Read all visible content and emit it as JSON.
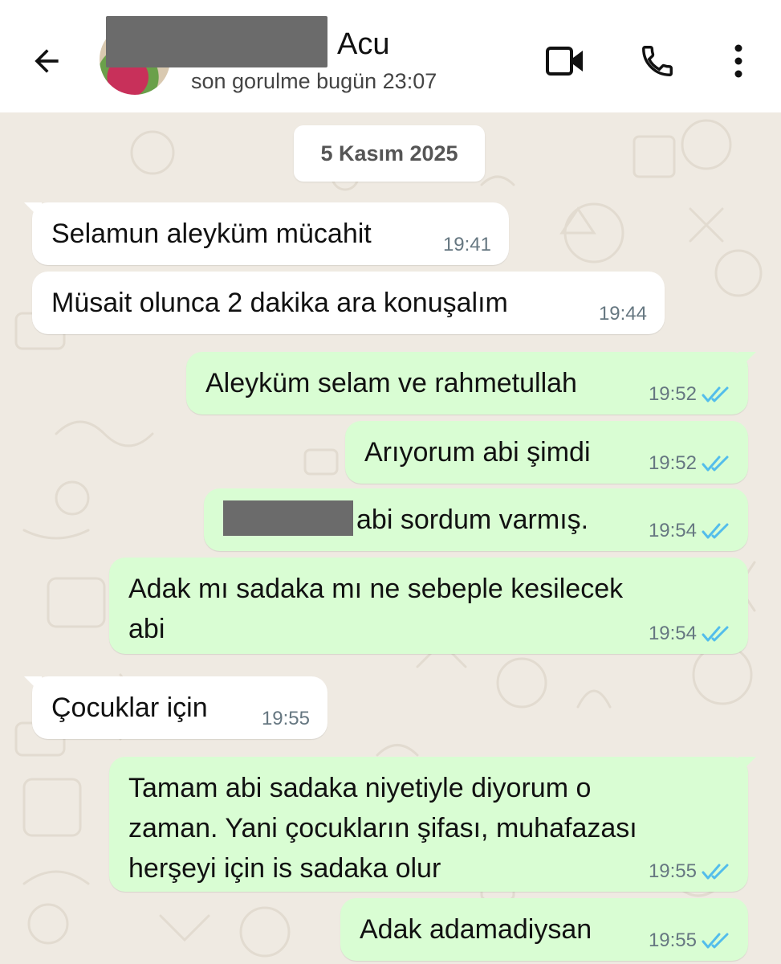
{
  "header": {
    "contact_name": "Acu",
    "status": "son gorulme bugün 23:07",
    "icons": [
      "back-arrow-icon",
      "video-call-icon",
      "phone-icon",
      "more-vertical-icon"
    ]
  },
  "chat": {
    "date_chip": "5 Kasım 2025",
    "messages": [
      {
        "dir": "in",
        "text": "Selamun aleyküm mücahit",
        "time": "19:41"
      },
      {
        "dir": "in",
        "text": "Müsait olunca 2 dakika ara konuşalım",
        "time": "19:44"
      },
      {
        "dir": "out",
        "text": "Aleyküm selam ve rahmetullah",
        "time": "19:52",
        "status": "read"
      },
      {
        "dir": "out",
        "text": "Arıyorum abi şimdi",
        "time": "19:52",
        "status": "read"
      },
      {
        "dir": "out",
        "text": "abi sordum varmış.",
        "time": "19:54",
        "status": "read"
      },
      {
        "dir": "out",
        "line1": "Adak mı sadaka mı ne sebeple kesilecek",
        "line2": "abi",
        "time": "19:54",
        "status": "read"
      },
      {
        "dir": "in",
        "text": "Çocuklar için",
        "time": "19:55"
      },
      {
        "dir": "out",
        "line1": "Tamam abi sadaka niyetiyle diyorum o",
        "line2": "zaman. Yani çocukların şifası, muhafazası",
        "line3": "herşeyi için is sadaka olur",
        "time": "19:55",
        "status": "read"
      },
      {
        "dir": "out",
        "text": "Adak adamadiysan",
        "time": "19:55",
        "status": "read"
      }
    ]
  },
  "colors": {
    "incoming_bubble": "#ffffff",
    "outgoing_bubble": "#d9fdd3",
    "chat_background": "#efeae2",
    "read_ticks": "#53bdeb",
    "timestamp": "#667781"
  }
}
